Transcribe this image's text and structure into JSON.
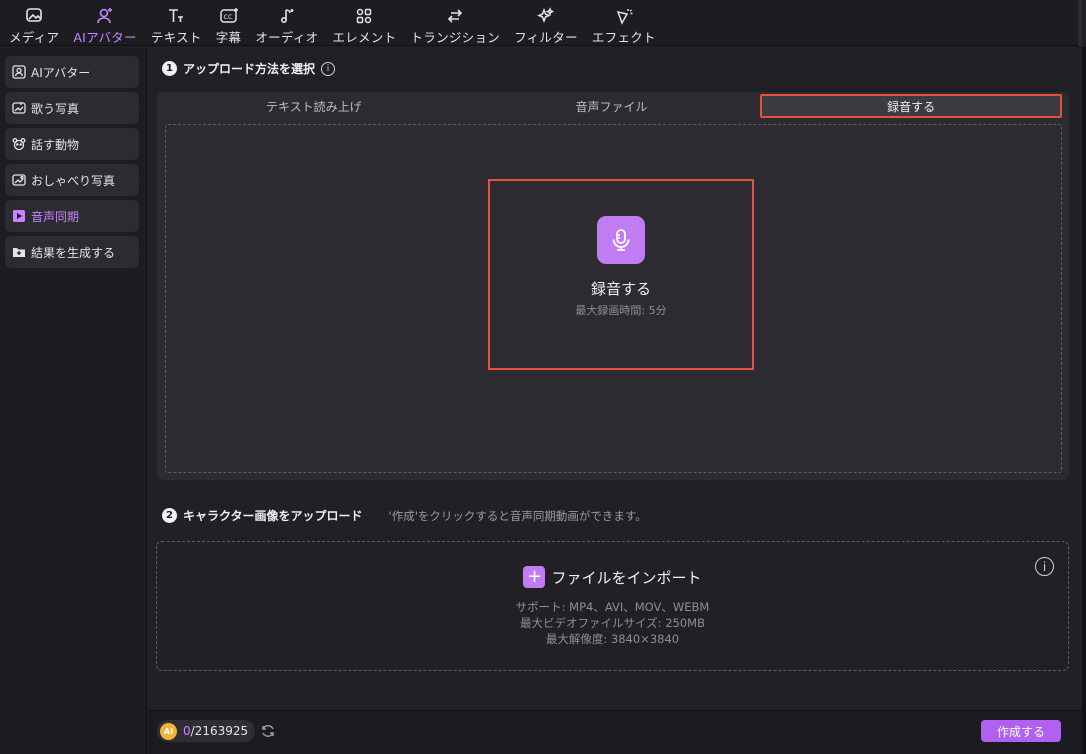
{
  "toolbar": {
    "items": [
      {
        "label": "メディア",
        "icon": "media-icon",
        "active": false
      },
      {
        "label": "AIアバター",
        "icon": "ai-avatar-icon",
        "active": true
      },
      {
        "label": "テキスト",
        "icon": "text-icon",
        "active": false
      },
      {
        "label": "字幕",
        "icon": "subtitle-icon",
        "active": false
      },
      {
        "label": "オーディオ",
        "icon": "audio-icon",
        "active": false
      },
      {
        "label": "エレメント",
        "icon": "element-icon",
        "active": false
      },
      {
        "label": "トランジション",
        "icon": "transition-icon",
        "active": false
      },
      {
        "label": "フィルター",
        "icon": "filter-icon",
        "active": false
      },
      {
        "label": "エフェクト",
        "icon": "effect-icon",
        "active": false
      }
    ]
  },
  "sidebar": {
    "items": [
      {
        "label": "AIアバター",
        "icon": "avatar-icon",
        "active": false
      },
      {
        "label": "歌う写真",
        "icon": "singing-photo-icon",
        "active": false
      },
      {
        "label": "話す動物",
        "icon": "talking-animal-icon",
        "active": false
      },
      {
        "label": "おしゃべり写真",
        "icon": "talking-photo-icon",
        "active": false
      },
      {
        "label": "音声同期",
        "icon": "lip-sync-icon",
        "active": true
      },
      {
        "label": "結果を生成する",
        "icon": "generated-results-icon",
        "active": false
      }
    ]
  },
  "step1": {
    "number": "1",
    "title": "アップロード方法を選択",
    "info_icon": "info-icon",
    "tabs": [
      {
        "label": "テキスト読み上げ",
        "selected": false
      },
      {
        "label": "音声ファイル",
        "selected": false
      },
      {
        "label": "録音する",
        "selected": true
      }
    ],
    "record": {
      "icon": "microphone-icon",
      "title": "録音する",
      "subtitle": "最大録画時間: 5分"
    }
  },
  "step2": {
    "number": "2",
    "title": "キャラクター画像をアップロード",
    "hint": "'作成'をクリックすると音声同期動画ができます。",
    "import_label": "ファイルをインポート",
    "specs": [
      "サポート: MP4、AVI、MOV、WEBM",
      "最大ビデオファイルサイズ: 250MB",
      "最大解像度: 3840×3840"
    ]
  },
  "footer": {
    "coin_label": "AI",
    "credits_used": "0",
    "credits_total": "/2163925",
    "create_label": "作成する"
  },
  "colors": {
    "accent": "#c984ff",
    "button": "#b160f0",
    "highlight_border": "#e4513f",
    "coin": "#f2b43a"
  }
}
